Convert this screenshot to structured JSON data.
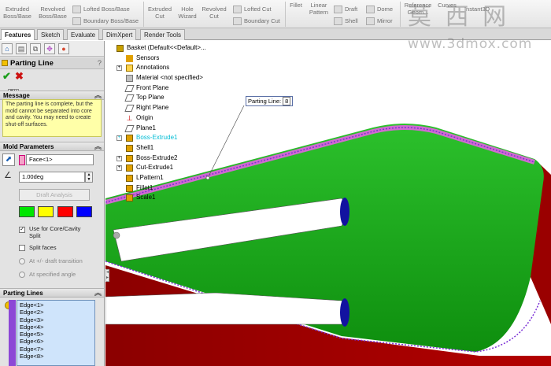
{
  "ribbon": {
    "extruded_boss_base": "Extruded\nBoss/Base",
    "revolved_boss_base": "Revolved\nBoss/Base",
    "lofted_boss_base": "Lofted Boss/Base",
    "boundary_boss_base": "Boundary Boss/Base",
    "extruded_cut": "Extruded\nCut",
    "hole_wizard": "Hole\nWizard",
    "revolved_cut": "Revolved\nCut",
    "lofted_cut": "Lofted Cut",
    "boundary_cut": "Boundary Cut",
    "fillet": "Fillet",
    "linear_pattern": "Linear\nPattern",
    "draft": "Draft",
    "shell": "Shell",
    "dome": "Dome",
    "mirror": "Mirror",
    "reference_geometry": "Reference\nGeom...",
    "curves": "Curves",
    "instant3d": "Instant3D"
  },
  "watermark": {
    "chars": "莫 西 网",
    "url": "www.3dmox.com"
  },
  "tabs": [
    "Features",
    "Sketch",
    "Evaluate",
    "DimXpert",
    "Render Tools"
  ],
  "pm": {
    "title": "Parting Line",
    "help": "?",
    "ok_tip": "OK",
    "message_header": "Message",
    "message": "The parting line is complete, but the mold cannot be separated into core and cavity. You may need to create shut-off surfaces.",
    "mold_params_header": "Mold Parameters",
    "face_value": "Face<1>",
    "angle_value": "1.00deg",
    "draft_analysis": "Draft Analysis",
    "swatch_colors": [
      "#00e600",
      "#ffff00",
      "#ff0000",
      "#0000ff"
    ],
    "use_core_cavity": "Use for Core/Cavity\nSplit",
    "split_faces": "Split faces",
    "at_transition": "At +/- draft transition",
    "at_angle": "At specified angle",
    "parting_lines_header": "Parting Lines",
    "edges": [
      "Edge<1>",
      "Edge<2>",
      "Edge<3>",
      "Edge<4>",
      "Edge<5>",
      "Edge<6>",
      "Edge<7>",
      "Edge<8>"
    ]
  },
  "tree": {
    "root": "Basket  (Default<<Default>...",
    "items": [
      "Sensors",
      "Annotations",
      "Material <not specified>",
      "Front Plane",
      "Top Plane",
      "Right Plane",
      "Origin",
      "Plane1",
      "Boss-Extrude1",
      "Shell1",
      "Boss-Extrude2",
      "Cut-Extrude1",
      "LPattern1",
      "Fillet1",
      "Scale1"
    ]
  },
  "callout": {
    "label": "Parting Line:",
    "count": "8"
  },
  "colors": {
    "model_green": "#1aa51a",
    "model_red": "#a00000",
    "parting_line": "#8a2be2",
    "accent_cyan": "#00bcd4"
  }
}
